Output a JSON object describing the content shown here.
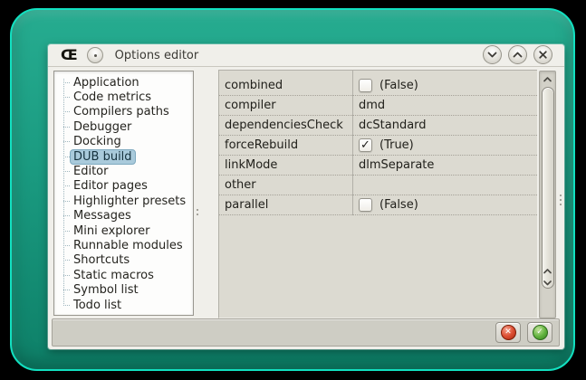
{
  "window": {
    "title": "Options editor",
    "app_icon_glyph": "Œ",
    "controls": {
      "minimize": "chevron-down",
      "maximize": "chevron-up",
      "close": "close"
    }
  },
  "sidebar": {
    "items": [
      "Application",
      "Code metrics",
      "Compilers paths",
      "Debugger",
      "Docking",
      "DUB build",
      "Editor",
      "Editor pages",
      "Highlighter presets",
      "Messages",
      "Mini explorer",
      "Runnable modules",
      "Shortcuts",
      "Static macros",
      "Symbol list",
      "Todo list"
    ],
    "selected": "DUB build"
  },
  "grid": {
    "rows": [
      {
        "name": "combined",
        "value": "(False)",
        "check_glyph": ""
      },
      {
        "name": "compiler",
        "value": "dmd"
      },
      {
        "name": "dependenciesCheck",
        "value": "dcStandard"
      },
      {
        "name": "forceRebuild",
        "value": "(True)",
        "check_glyph": "✓"
      },
      {
        "name": "linkMode",
        "value": "dlmSeparate"
      },
      {
        "name": "other",
        "value": ""
      },
      {
        "name": "parallel",
        "value": "(False)",
        "check_glyph": ""
      }
    ]
  },
  "footer": {
    "cancel_glyph": "✕",
    "ok_glyph": "✓"
  },
  "colors": {
    "frame_teal": "#1a9a80",
    "frame_rim": "#12e0c0",
    "selection_blue": "#a9cadb",
    "cancel_red": "#dd4f33",
    "ok_green": "#5fb13b"
  }
}
